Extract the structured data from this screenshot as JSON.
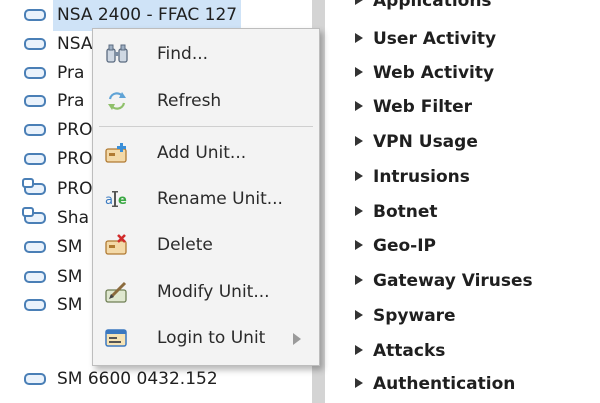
{
  "tree": {
    "rows": [
      {
        "label": "NSA 2400 - FFAC 127",
        "icon": "device-icon",
        "selected": true
      },
      {
        "label": "NSA",
        "icon": "device-icon"
      },
      {
        "label": "Pra",
        "icon": "device-icon"
      },
      {
        "label": "Pra",
        "icon": "device-icon"
      },
      {
        "label": "PRO",
        "icon": "device-icon"
      },
      {
        "label": "PRO",
        "icon": "device-icon"
      },
      {
        "label": "PRO",
        "icon": "linked-device-icon"
      },
      {
        "label": "Sha",
        "icon": "linked-device-icon"
      },
      {
        "label": "SM",
        "icon": "device-icon"
      },
      {
        "label": "SM",
        "icon": "device-icon"
      },
      {
        "label": "SM",
        "icon": "device-icon"
      },
      {
        "label": "SM 6600 0432.152",
        "icon": "device-icon"
      }
    ]
  },
  "menu": {
    "items": [
      {
        "label": "Find...",
        "icon": "binoculars-icon"
      },
      {
        "label": "Refresh",
        "icon": "refresh-icon"
      },
      {
        "label": "Add Unit...",
        "icon": "add-unit-icon"
      },
      {
        "label": "Rename Unit...",
        "icon": "rename-icon"
      },
      {
        "label": "Delete",
        "icon": "delete-icon"
      },
      {
        "label": "Modify Unit...",
        "icon": "modify-icon"
      },
      {
        "label": "Login to Unit",
        "icon": "login-icon",
        "submenu": true
      }
    ]
  },
  "reports": {
    "clipped_item": "Applications",
    "items": [
      "User Activity",
      "Web Activity",
      "Web Filter",
      "VPN Usage",
      "Intrusions",
      "Botnet",
      "Geo-IP",
      "Gateway Viruses",
      "Spyware",
      "Attacks",
      "Authentication"
    ]
  }
}
